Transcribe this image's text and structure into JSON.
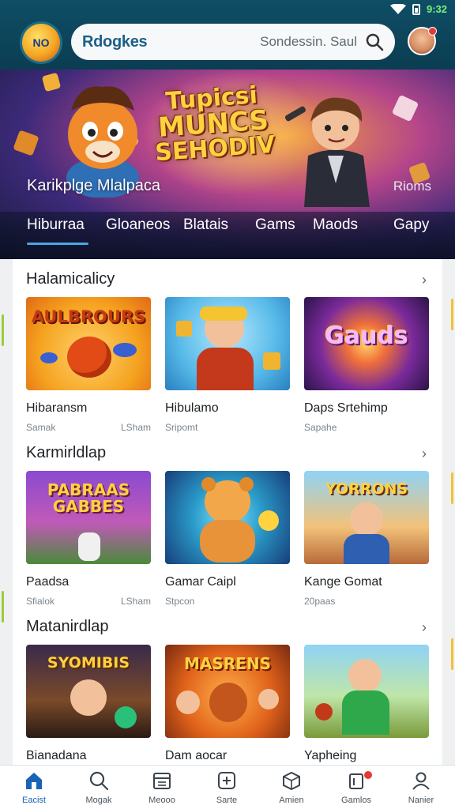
{
  "status": {
    "time": "9:32"
  },
  "header": {
    "logo_text": "NO",
    "search_brand": "Rdogkes",
    "search_placeholder": "Sondessin.  Saul"
  },
  "hero": {
    "title_lines": [
      "Tupicsi",
      "MUNCS",
      "SEHODIV"
    ],
    "subtitle": "Karikplge Mlalpaca",
    "more": "Rioms",
    "tabs": [
      "Hiburraa",
      "Gloaneos",
      "Blatais",
      "Gams",
      "Maods",
      "Gapy"
    ]
  },
  "sections": [
    {
      "title": "Halamicalicy",
      "cards": [
        {
          "art": "AULBROURS",
          "name": "Hibaransm",
          "meta_left": "Samak",
          "meta_right": "LSham"
        },
        {
          "art": "",
          "name": "Hibulamo",
          "meta_left": "Sripomt",
          "meta_right": ""
        },
        {
          "art": "Gauds",
          "name": "Daps Srtehimp",
          "meta_left": "Sapahe",
          "meta_right": ""
        }
      ]
    },
    {
      "title": "Karmirldlap",
      "cards": [
        {
          "art": "PABRAAS GABBES",
          "name": "Paadsa",
          "meta_left": "Sfialok",
          "meta_right": "LSham"
        },
        {
          "art": "",
          "name": "Gamar Caipl",
          "meta_left": "Stpcon",
          "meta_right": ""
        },
        {
          "art": "YORRONS",
          "name": "Kange Gomat",
          "meta_left": "20paas",
          "meta_right": ""
        }
      ]
    },
    {
      "title": "Matanirdlap",
      "cards": [
        {
          "art": "SYOMIBIS",
          "name": "Bianadana",
          "meta_left": "",
          "meta_right": ""
        },
        {
          "art": "MASRENS",
          "name": "Dam aocar",
          "meta_left": "",
          "meta_right": ""
        },
        {
          "art": "",
          "name": "Yapheing",
          "meta_left": "",
          "meta_right": ""
        }
      ]
    }
  ],
  "bottom_nav": [
    {
      "label": "Eacist",
      "icon": "home-icon",
      "active": true
    },
    {
      "label": "Mogak",
      "icon": "search-icon",
      "active": false
    },
    {
      "label": "Meooo",
      "icon": "calendar-icon",
      "active": false
    },
    {
      "label": "Sarte",
      "icon": "gamepad-icon",
      "active": false
    },
    {
      "label": "Amien",
      "icon": "package-icon",
      "active": false
    },
    {
      "label": "Gamlos",
      "icon": "notification-icon",
      "active": false
    },
    {
      "label": "Nanier",
      "icon": "profile-icon",
      "active": false
    }
  ]
}
